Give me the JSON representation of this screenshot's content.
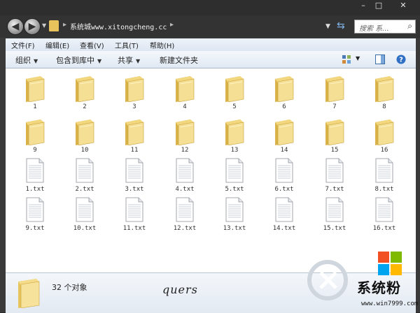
{
  "window": {
    "caption_buttons": [
      "–",
      "□",
      "✕"
    ],
    "path": {
      "prefix": "▸",
      "location": "系统城www.xitongcheng.cc",
      "suffix": "▸"
    },
    "search_placeholder": "搜索 系..."
  },
  "menu": [
    {
      "label": "文件(F)"
    },
    {
      "label": "编辑(E)"
    },
    {
      "label": "查看(V)"
    },
    {
      "label": "工具(T)"
    },
    {
      "label": "帮助(H)"
    }
  ],
  "toolbar": {
    "organize": "组织",
    "include_in_library": "包含到库中",
    "share": "共享",
    "new_folder": "新建文件夹"
  },
  "items": [
    {
      "type": "folder",
      "name": "1"
    },
    {
      "type": "folder",
      "name": "2"
    },
    {
      "type": "folder",
      "name": "3"
    },
    {
      "type": "folder",
      "name": "4"
    },
    {
      "type": "folder",
      "name": "5"
    },
    {
      "type": "folder",
      "name": "6"
    },
    {
      "type": "folder",
      "name": "7"
    },
    {
      "type": "folder",
      "name": "8"
    },
    {
      "type": "folder",
      "name": "9"
    },
    {
      "type": "folder",
      "name": "10"
    },
    {
      "type": "folder",
      "name": "11"
    },
    {
      "type": "folder",
      "name": "12"
    },
    {
      "type": "folder",
      "name": "13"
    },
    {
      "type": "folder",
      "name": "14"
    },
    {
      "type": "folder",
      "name": "15"
    },
    {
      "type": "folder",
      "name": "16"
    },
    {
      "type": "file",
      "name": "1.txt"
    },
    {
      "type": "file",
      "name": "2.txt"
    },
    {
      "type": "file",
      "name": "3.txt"
    },
    {
      "type": "file",
      "name": "4.txt"
    },
    {
      "type": "file",
      "name": "5.txt"
    },
    {
      "type": "file",
      "name": "6.txt"
    },
    {
      "type": "file",
      "name": "7.txt"
    },
    {
      "type": "file",
      "name": "8.txt"
    },
    {
      "type": "file",
      "name": "9.txt"
    },
    {
      "type": "file",
      "name": "10.txt"
    },
    {
      "type": "file",
      "name": "11.txt"
    },
    {
      "type": "file",
      "name": "12.txt"
    },
    {
      "type": "file",
      "name": "13.txt"
    },
    {
      "type": "file",
      "name": "14.txt"
    },
    {
      "type": "file",
      "name": "15.txt"
    },
    {
      "type": "file",
      "name": "16.txt"
    }
  ],
  "details": {
    "count": "32 个对象",
    "signature": "quers"
  },
  "watermark": {
    "brand": "系统粉",
    "url": "www.win7999.com"
  }
}
